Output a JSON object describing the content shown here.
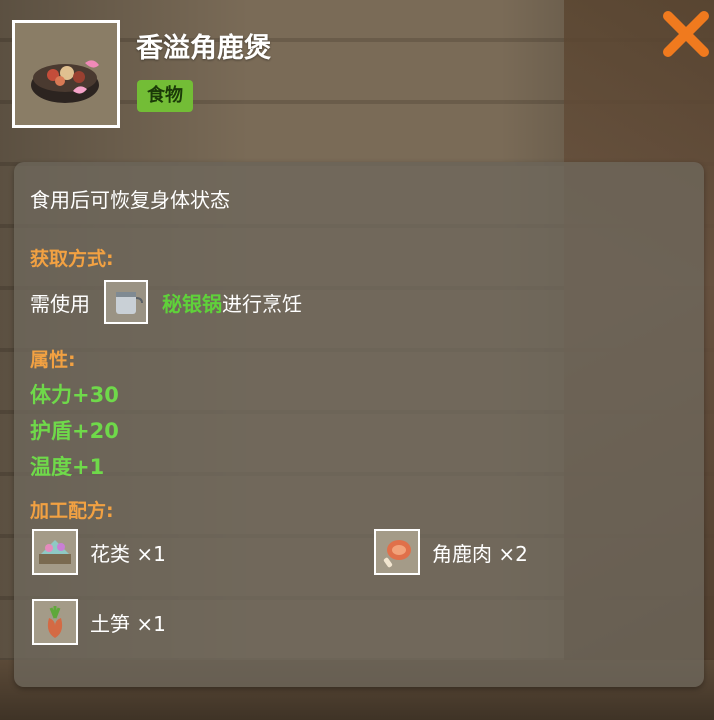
{
  "item": {
    "title": "香溢角鹿煲",
    "tag": "食物",
    "icon": "stew-pot-icon"
  },
  "description": "食用后可恢复身体状态",
  "acquisition": {
    "label": "获取方式:",
    "prefix": "需使用",
    "tool_name": "秘银锅",
    "suffix": "进行烹饪",
    "tool_icon": "mithril-pot-icon"
  },
  "attributes": {
    "label": "属性:",
    "items": [
      "体力+30",
      "护盾+20",
      "温度+1"
    ]
  },
  "recipe": {
    "label": "加工配方:",
    "ingredients": [
      {
        "name": "花类 ×1",
        "icon": "flower-icon"
      },
      {
        "name": "角鹿肉 ×2",
        "icon": "deer-meat-icon"
      },
      {
        "name": "土笋 ×1",
        "icon": "earth-bamboo-shoot-icon"
      }
    ]
  },
  "colors": {
    "tag_bg": "#73bd36",
    "section_label": "#f2a142",
    "stat_text": "#6fd94a",
    "close": "#f07a1e"
  }
}
